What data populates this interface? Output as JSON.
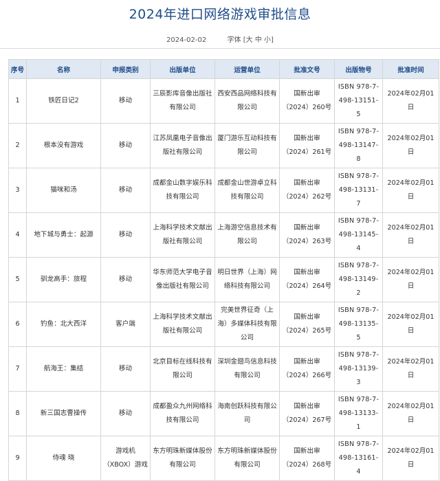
{
  "header": {
    "title": "2024年进口网络游戏审批信息",
    "date": "2024-02-02",
    "font_label": "字体",
    "size_open": "[",
    "size_large": "大",
    "size_medium": "中",
    "size_small": "小",
    "size_close": "]"
  },
  "table": {
    "columns": [
      "序号",
      "名称",
      "申报类别",
      "出版单位",
      "运营单位",
      "批准文号",
      "出版物号",
      "批准时间"
    ],
    "rows": [
      {
        "no": "1",
        "name": "铁匠日记2",
        "category": "移动",
        "publisher": "三辰影库音像出版社有限公司",
        "operator": "西安西品网络科技有限公司",
        "approval": "国新出审（2024）260号",
        "isbn": "ISBN 978-7-498-13151-5",
        "date": "2024年02月01日"
      },
      {
        "no": "2",
        "name": "根本没有游戏",
        "category": "移动",
        "publisher": "江苏凤凰电子音像出版社有限公司",
        "operator": "厦门游乐互动科技有限公司",
        "approval": "国新出审（2024）261号",
        "isbn": "ISBN 978-7-498-13147-8",
        "date": "2024年02月01日"
      },
      {
        "no": "3",
        "name": "猫咪和汤",
        "category": "移动",
        "publisher": "成都金山数字娱乐科技有限公司",
        "operator": "成都金山世游卓立科技有限公司",
        "approval": "国新出审（2024）262号",
        "isbn": "ISBN 978-7-498-13131-7",
        "date": "2024年02月01日"
      },
      {
        "no": "4",
        "name": "地下城与勇士：起源",
        "category": "移动",
        "publisher": "上海科学技术文献出版社有限公司",
        "operator": "上海游空信息技术有限公司",
        "approval": "国新出审（2024）263号",
        "isbn": "ISBN 978-7-498-13145-4",
        "date": "2024年02月01日"
      },
      {
        "no": "5",
        "name": "驯龙高手：旅程",
        "category": "移动",
        "publisher": "华东师范大学电子音像出版社有限公司",
        "operator": "明日世界（上海）网络科技有限公司",
        "approval": "国新出审（2024）264号",
        "isbn": "ISBN 978-7-498-13149-2",
        "date": "2024年02月01日"
      },
      {
        "no": "6",
        "name": "钓鱼：北大西洋",
        "category": "客户端",
        "publisher": "上海科学技术文献出版社有限公司",
        "operator": "完美世界征奇（上海）多媒体科技有限公司",
        "approval": "国新出审（2024）265号",
        "isbn": "ISBN 978-7-498-13135-5",
        "date": "2024年02月01日"
      },
      {
        "no": "7",
        "name": "航海王：集结",
        "category": "移动",
        "publisher": "北京目标在线科技有限公司",
        "operator": "深圳金翅鸟信息科技有限公司",
        "approval": "国新出审（2024）266号",
        "isbn": "ISBN 978-7-498-13139-3",
        "date": "2024年02月01日"
      },
      {
        "no": "8",
        "name": "新三国志曹操传",
        "category": "移动",
        "publisher": "成都盈众九州网络科技有限公司",
        "operator": "海南创跃科技有限公司",
        "approval": "国新出审（2024）267号",
        "isbn": "ISBN 978-7-498-13133-1",
        "date": "2024年02月01日"
      },
      {
        "no": "9",
        "name": "侍魂 晓",
        "category": "游戏机（XBOX）游戏",
        "publisher": "东方明珠新媒体股份有限公司",
        "operator": "东方明珠新媒体股份有限公司",
        "approval": "国新出审（2024）268号",
        "isbn": "ISBN 978-7-498-13161-4",
        "date": "2024年02月01日"
      }
    ]
  }
}
